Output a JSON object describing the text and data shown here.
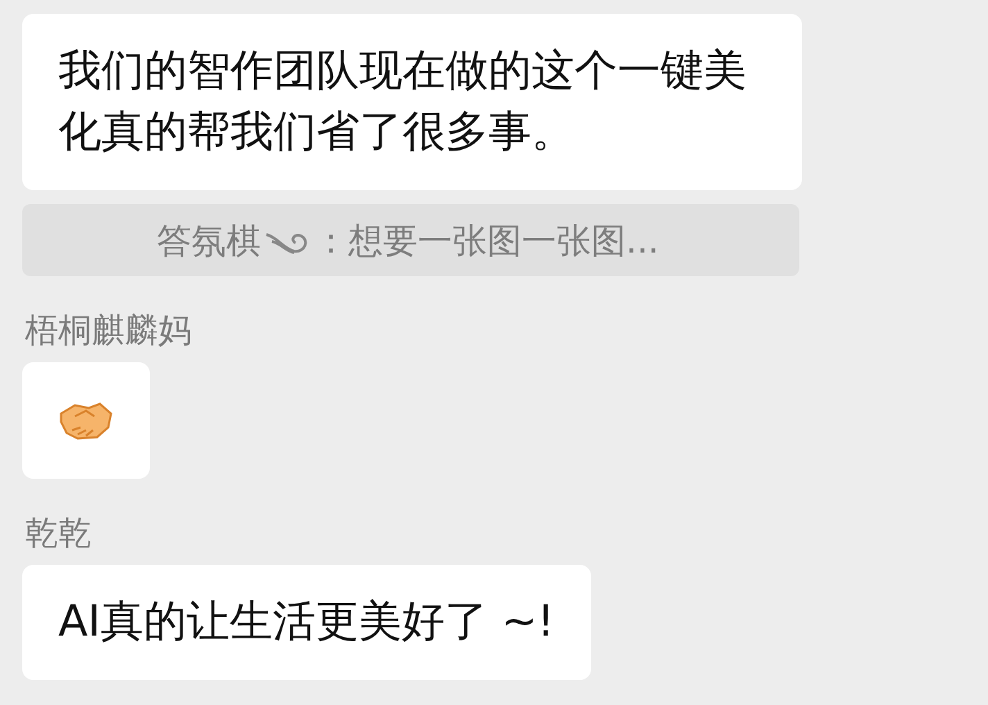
{
  "messages": [
    {
      "kind": "text",
      "text": "我们的智作团队现在做的这个一键美化真的帮我们省了很多事。"
    },
    {
      "kind": "quote",
      "sender": "答氛棋",
      "text": "：想要一张图一张图..."
    },
    {
      "kind": "emoji",
      "sender": "梧桐麒麟妈"
    },
    {
      "kind": "text",
      "sender": "乾乾",
      "text": "AI真的让生活更美好了 ~!"
    }
  ]
}
